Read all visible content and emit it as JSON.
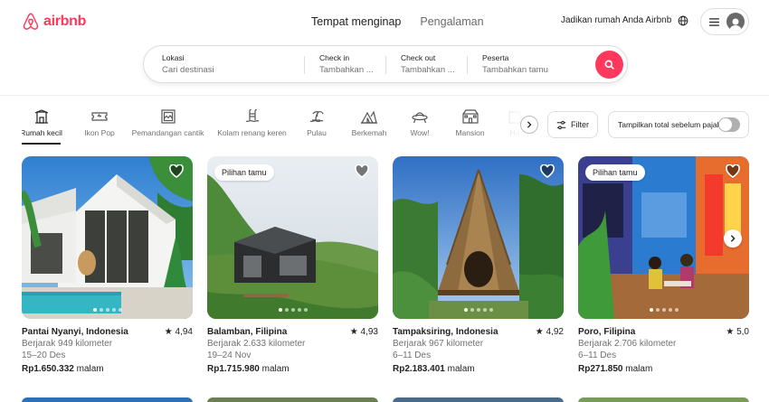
{
  "brand": {
    "name": "airbnb",
    "color": "#ff385c"
  },
  "nav": {
    "stays": "Tempat menginap",
    "experiences": "Pengalaman"
  },
  "host_link": "Jadikan rumah Anda Airbnb",
  "search": {
    "location": {
      "label": "Lokasi",
      "placeholder": "Cari destinasi"
    },
    "checkin": {
      "label": "Check in",
      "placeholder": "Tambahkan ..."
    },
    "checkout": {
      "label": "Check out",
      "placeholder": "Tambahkan ..."
    },
    "guests": {
      "label": "Peserta",
      "placeholder": "Tambahkan tamu"
    }
  },
  "categories": [
    {
      "label": "Rumah kecil",
      "icon": "tiny-home-icon",
      "active": true
    },
    {
      "label": "Ikon Pop",
      "icon": "ticket-icon",
      "active": false
    },
    {
      "label": "Pemandangan cantik",
      "icon": "framed-view-icon",
      "active": false
    },
    {
      "label": "Kolam renang keren",
      "icon": "pool-icon",
      "active": false
    },
    {
      "label": "Pulau",
      "icon": "island-icon",
      "active": false
    },
    {
      "label": "Berkemah",
      "icon": "camping-icon",
      "active": false
    },
    {
      "label": "Wow!",
      "icon": "ufo-icon",
      "active": false
    },
    {
      "label": "Mansion",
      "icon": "mansion-icon",
      "active": false
    },
    {
      "label": "Ha",
      "icon": "partial-icon",
      "active": false
    }
  ],
  "filter_label": "Filter",
  "tax_toggle_label": "Tampilkan total sebelum pajak",
  "listings": [
    {
      "title": "Pantai Nyanyi, Indonesia",
      "rating": "4,94",
      "distance": "Berjarak 949 kilometer",
      "dates": "15–20 Des",
      "price": "Rp1.650.332",
      "unit": "malam",
      "badge": ""
    },
    {
      "title": "Balamban, Filipina",
      "rating": "4,93",
      "distance": "Berjarak 2.633 kilometer",
      "dates": "19–24 Nov",
      "price": "Rp1.715.980",
      "unit": "malam",
      "badge": "Pilihan tamu"
    },
    {
      "title": "Tampaksiring, Indonesia",
      "rating": "4,92",
      "distance": "Berjarak 967 kilometer",
      "dates": "6–11 Des",
      "price": "Rp2.183.401",
      "unit": "malam",
      "badge": ""
    },
    {
      "title": "Poro, Filipina",
      "rating": "5,0",
      "distance": "Berjarak 2.706 kilometer",
      "dates": "6–11 Des",
      "price": "Rp271.850",
      "unit": "malam",
      "badge": "Pilihan tamu"
    }
  ]
}
